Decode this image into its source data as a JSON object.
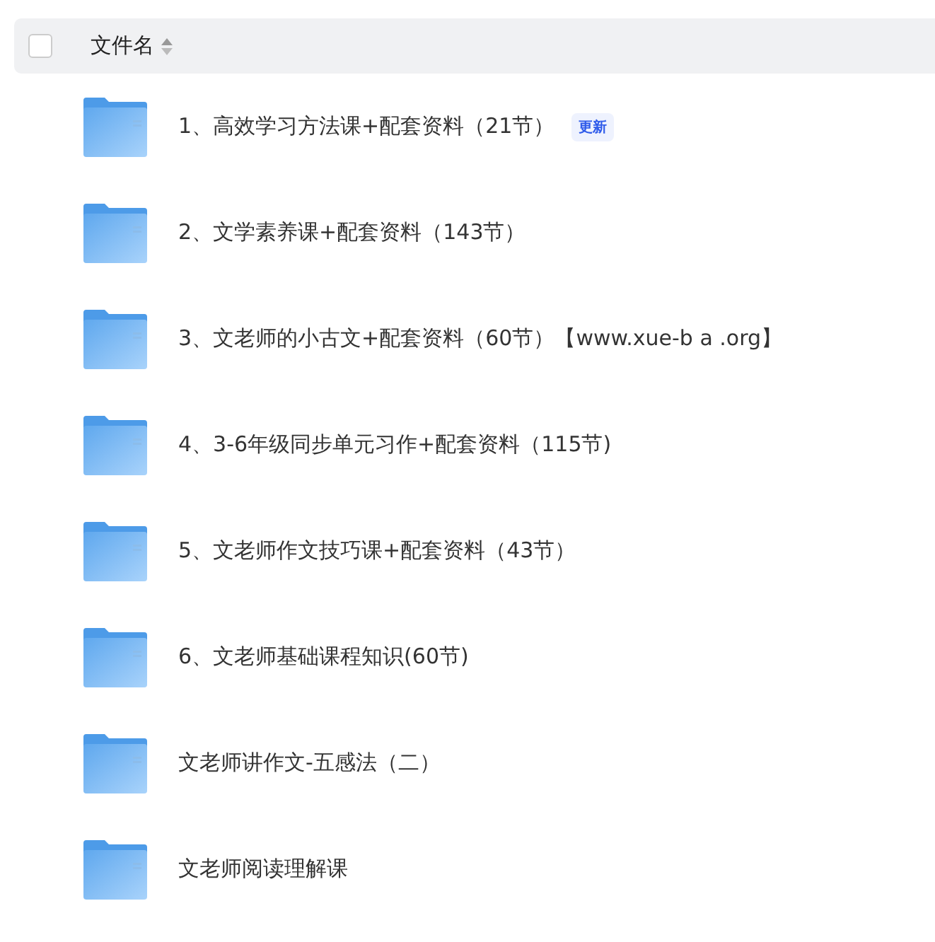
{
  "header": {
    "checked": false,
    "label": "文件名"
  },
  "files": [
    {
      "name": "1、高效学习方法课+配套资料（21节）",
      "badge": "更新"
    },
    {
      "name": "2、文学素养课+配套资料（143节）"
    },
    {
      "name": "3、文老师的小古文+配套资料（60节）【www.xue-b a .org】"
    },
    {
      "name": "4、3-6年级同步单元习作+配套资料（115节)"
    },
    {
      "name": "5、文老师作文技巧课+配套资料（43节）"
    },
    {
      "name": "6、文老师基础课程知识(60节)"
    },
    {
      "name": "文老师讲作文-五感法（二）"
    },
    {
      "name": "文老师阅读理解课"
    }
  ]
}
